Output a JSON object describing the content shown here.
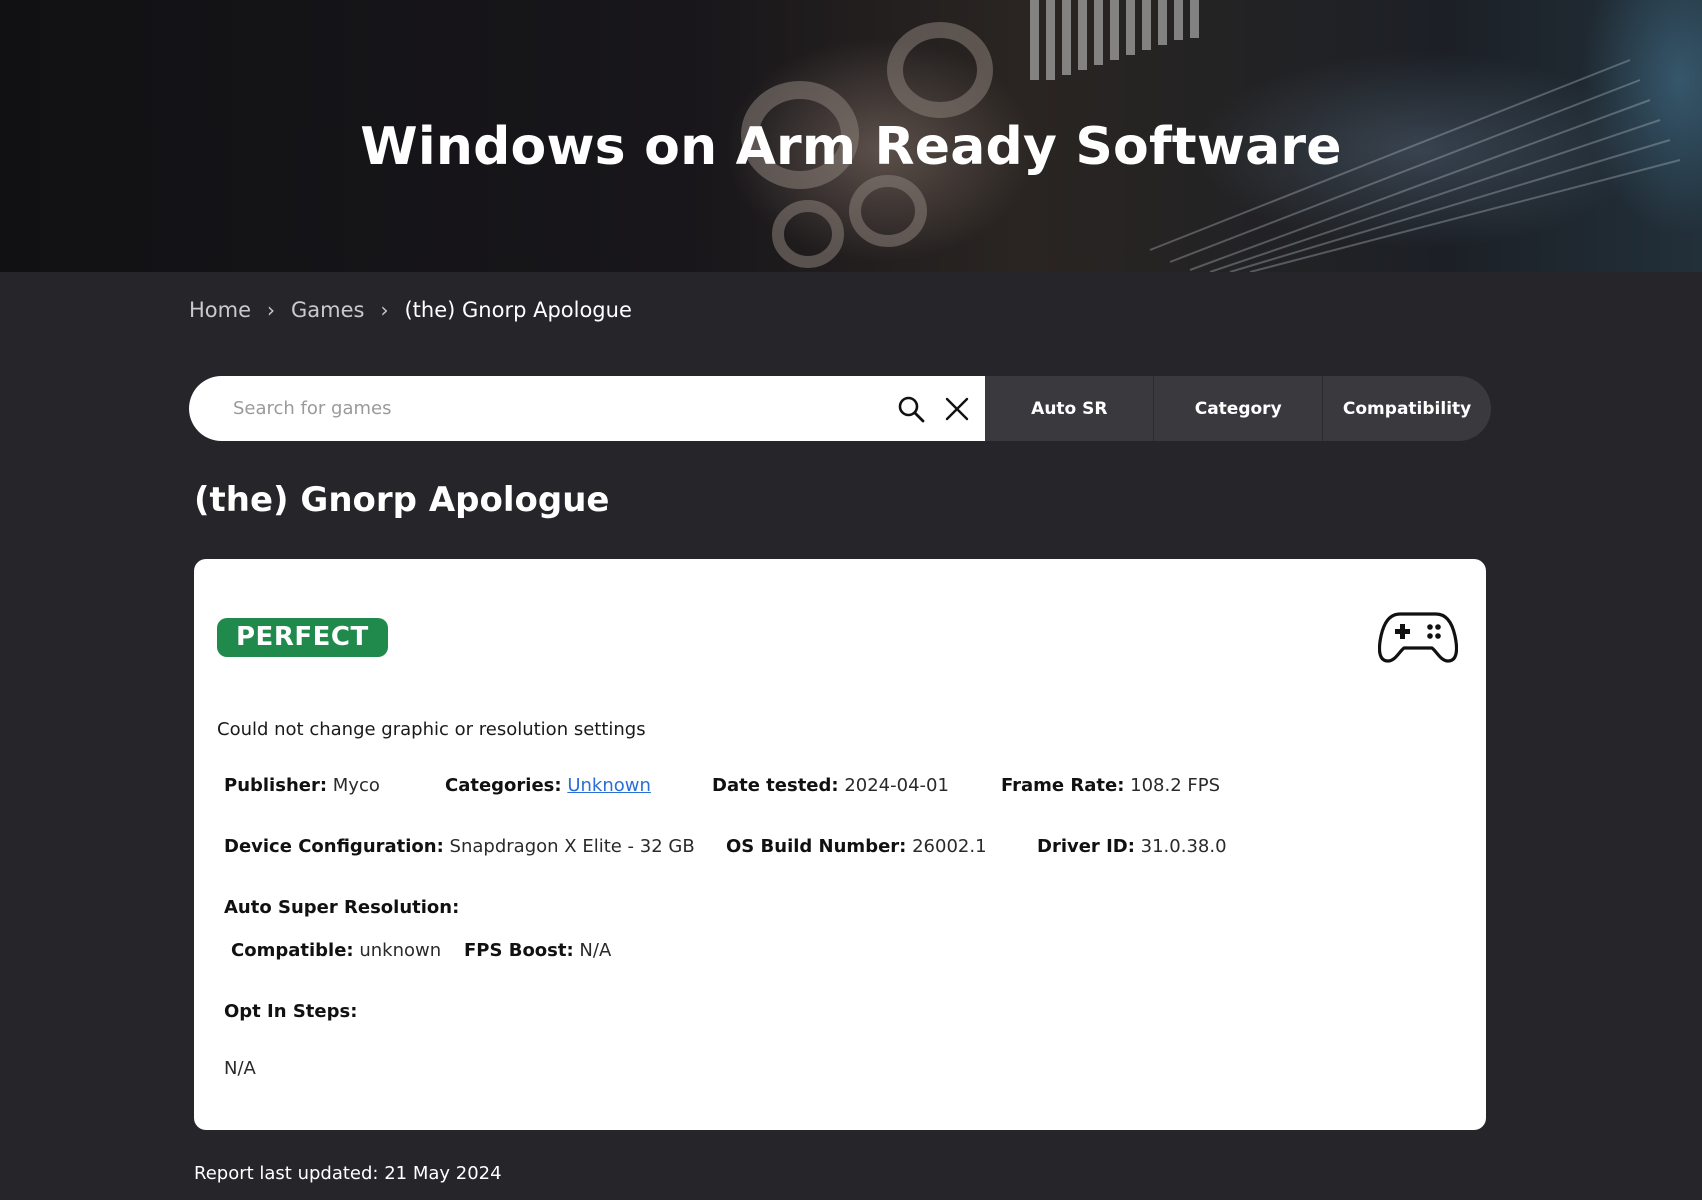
{
  "hero": {
    "title": "Windows on Arm Ready Software"
  },
  "breadcrumb": {
    "items": [
      "Home",
      "Games"
    ],
    "separator": "›",
    "current": "(the) Gnorp Apologue"
  },
  "search": {
    "placeholder": "Search for games",
    "value": "",
    "search_icon": "search-icon",
    "clear_icon": "close-icon"
  },
  "filters": {
    "auto_sr": "Auto SR",
    "category": "Category",
    "compatibility": "Compatibility"
  },
  "page": {
    "title": "(the) Gnorp Apologue"
  },
  "card": {
    "badge": "PERFECT",
    "badge_color": "#1f8a4c",
    "icon": "game-controller-icon",
    "note": "Could not change graphic or resolution settings",
    "publisher": {
      "label": "Publisher:",
      "value": "Myco"
    },
    "categories": {
      "label": "Categories:",
      "value": "Unknown"
    },
    "date_tested": {
      "label": "Date tested:",
      "value": "2024-04-01"
    },
    "frame_rate": {
      "label": "Frame Rate:",
      "value": "108.2 FPS"
    },
    "device_configuration": {
      "label": "Device Configuration:",
      "value": "Snapdragon X Elite - 32 GB"
    },
    "os_build_number": {
      "label": "OS Build Number:",
      "value": "26002.1"
    },
    "driver_id": {
      "label": "Driver ID:",
      "value": "31.0.38.0"
    },
    "auto_super_resolution": {
      "label": "Auto Super Resolution:"
    },
    "compatible": {
      "label": "Compatible:",
      "value": "unknown"
    },
    "fps_boost": {
      "label": "FPS Boost:",
      "value": "N/A"
    },
    "opt_in_steps": {
      "label": "Opt In Steps:",
      "value": "N/A"
    }
  },
  "footer": {
    "report_updated": "Report last updated: 21 May 2024"
  },
  "colors": {
    "background": "#25252a",
    "link": "#2a6fd6",
    "filter_bg": "#3a3a3e"
  }
}
